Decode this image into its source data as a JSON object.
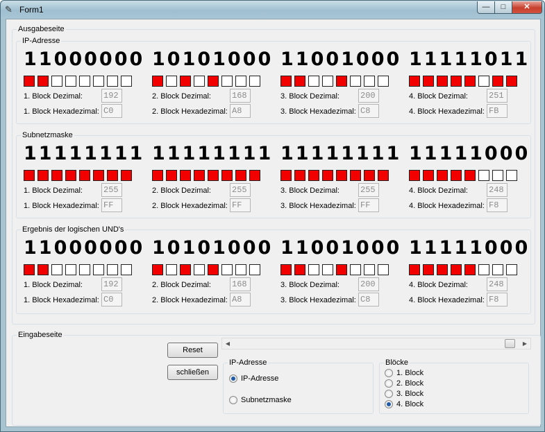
{
  "window": {
    "title": "Form1",
    "controls": [
      "—",
      "□",
      "✕"
    ]
  },
  "ausgabe": {
    "label": "Ausgabeseite",
    "sections": [
      {
        "label": "IP-Adresse",
        "blocks": [
          {
            "bits": "11000000",
            "dec_label": "1. Block Dezimal:",
            "hex_label": "1. Block Hexadezimal:",
            "dec": "192",
            "hex": "C0"
          },
          {
            "bits": "10101000",
            "dec_label": "2. Block Dezimal:",
            "hex_label": "2. Block Hexadezimal:",
            "dec": "168",
            "hex": "A8"
          },
          {
            "bits": "11001000",
            "dec_label": "3. Block Dezimal:",
            "hex_label": "3. Block Hexadezimal:",
            "dec": "200",
            "hex": "C8"
          },
          {
            "bits": "11111011",
            "dec_label": "4. Block Dezimal:",
            "hex_label": "4. Block Hexadezimal:",
            "dec": "251",
            "hex": "FB"
          }
        ]
      },
      {
        "label": "Subnetzmaske",
        "blocks": [
          {
            "bits": "11111111",
            "dec_label": "1. Block Dezimal:",
            "hex_label": "1. Block Hexadezimal:",
            "dec": "255",
            "hex": "FF"
          },
          {
            "bits": "11111111",
            "dec_label": "2. Block Dezimal:",
            "hex_label": "2. Block Hexadezimal:",
            "dec": "255",
            "hex": "FF"
          },
          {
            "bits": "11111111",
            "dec_label": "3. Block Dezimal:",
            "hex_label": "3. Block Hexadezimal:",
            "dec": "255",
            "hex": "FF"
          },
          {
            "bits": "11111000",
            "dec_label": "4. Block Dezimal:",
            "hex_label": "4. Block Hexadezimal:",
            "dec": "248",
            "hex": "F8"
          }
        ]
      },
      {
        "label": "Ergebnis der logischen UND's",
        "blocks": [
          {
            "bits": "11000000",
            "dec_label": "1. Block Dezimal:",
            "hex_label": "1. Block Hexadezimal:",
            "dec": "192",
            "hex": "C0"
          },
          {
            "bits": "10101000",
            "dec_label": "2. Block Dezimal:",
            "hex_label": "2. Block Hexadezimal:",
            "dec": "168",
            "hex": "A8"
          },
          {
            "bits": "11001000",
            "dec_label": "3. Block Dezimal:",
            "hex_label": "3. Block Hexadezimal:",
            "dec": "200",
            "hex": "C8"
          },
          {
            "bits": "11111000",
            "dec_label": "4. Block Dezimal:",
            "hex_label": "4. Block Hexadezimal:",
            "dec": "248",
            "hex": "F8"
          }
        ]
      }
    ]
  },
  "eingabe": {
    "label": "Eingabeseite",
    "reset_label": "Reset",
    "close_label": "schließen",
    "slider_level": 1.0,
    "ip_group": {
      "label": "IP-Adresse",
      "options": [
        {
          "label": "IP-Adresse",
          "selected": true
        },
        {
          "label": "Subnetzmaske",
          "selected": false
        }
      ]
    },
    "blocks_group": {
      "label": "Blöcke",
      "options": [
        {
          "label": "1. Block",
          "selected": false
        },
        {
          "label": "2. Block",
          "selected": false
        },
        {
          "label": "3. Block",
          "selected": false
        },
        {
          "label": "4. Block",
          "selected": true
        }
      ]
    }
  },
  "colors": {
    "led_on": "#f20000",
    "led_off": "#ffffff"
  }
}
